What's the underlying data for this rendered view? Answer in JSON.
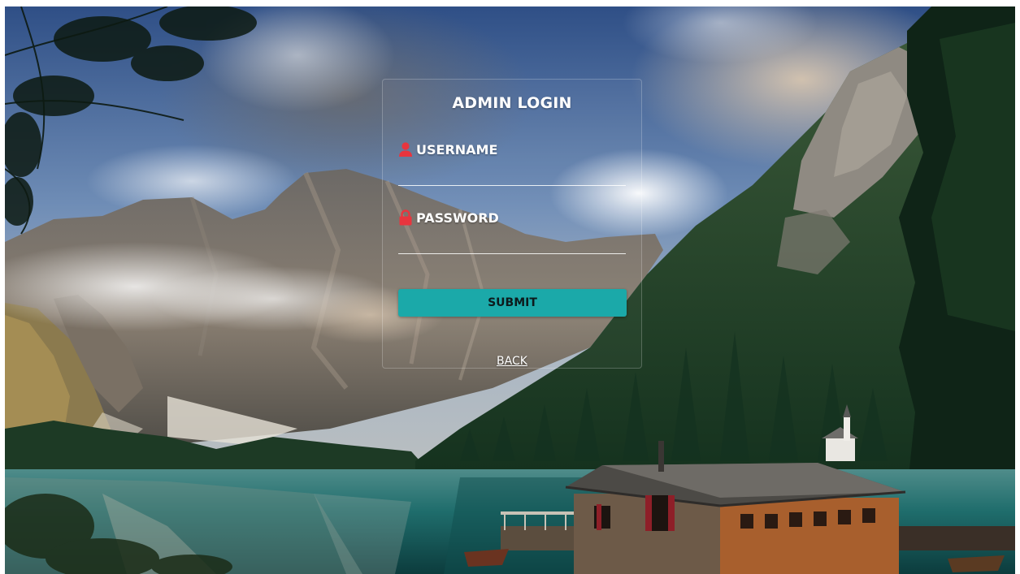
{
  "login": {
    "title": "ADMIN LOGIN",
    "username_label": "USERNAME",
    "username_value": "",
    "password_label": "PASSWORD",
    "password_value": "",
    "submit_label": "SUBMIT",
    "back_label": "BACK"
  },
  "icons": {
    "username": "user-icon",
    "password": "lock-icon"
  },
  "colors": {
    "accent": "#1ba9a9",
    "icon": "#e8353e",
    "text": "#ffffff"
  }
}
